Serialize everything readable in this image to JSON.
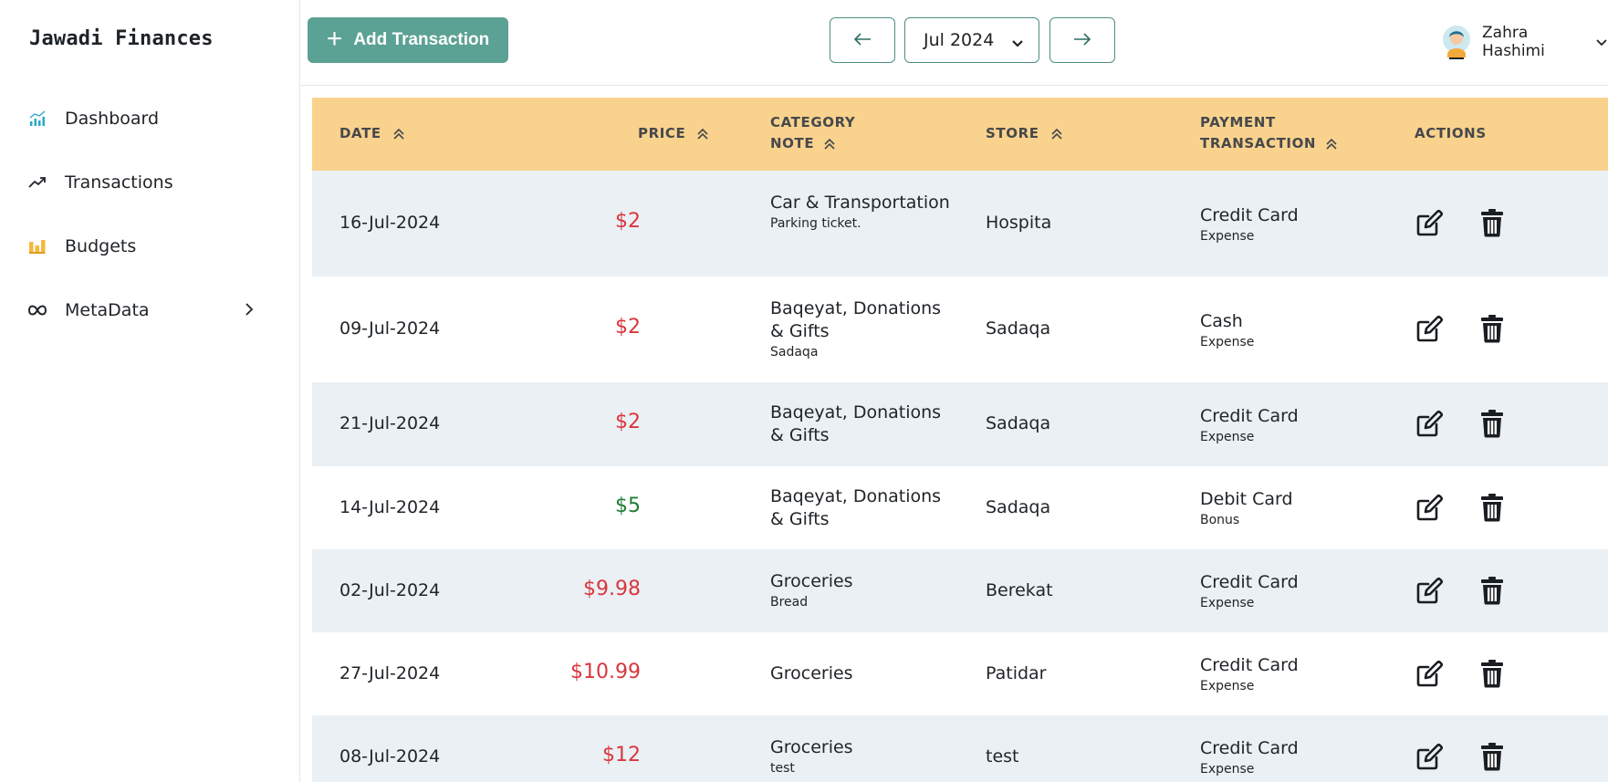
{
  "sidebar": {
    "brand": "Jawadi Finances",
    "items": [
      {
        "label": "Dashboard",
        "icon": "chart-bar-icon"
      },
      {
        "label": "Transactions",
        "icon": "trend-up-icon"
      },
      {
        "label": "Budgets",
        "icon": "budget-bars-icon"
      },
      {
        "label": "MetaData",
        "icon": "meta-infinity-icon"
      }
    ]
  },
  "header": {
    "add_label": "Add Transaction",
    "month": "Jul 2024",
    "user_name": "Zahra Hashimi"
  },
  "colors": {
    "accent": "#5ba194",
    "header_bg": "#f9d28d",
    "row_alt": "#ebf0f4",
    "expense": "#d9363e",
    "income": "#1e7e34"
  },
  "table": {
    "headers": {
      "date": "DATE",
      "price": "PRICE",
      "category_line1": "CATEGORY",
      "category_line2": "NOTE",
      "store": "STORE",
      "payment_line1": "PAYMENT",
      "payment_line2": "TRANSACTION",
      "actions": "ACTIONS"
    },
    "rows": [
      {
        "date": "16-Jul-2024",
        "price": "$2",
        "type": "expense",
        "category": "Car & Transportation",
        "note": "Parking ticket.",
        "store": "Hospita",
        "payment": "Credit Card",
        "transaction": "Expense"
      },
      {
        "date": "09-Jul-2024",
        "price": "$2",
        "type": "expense",
        "category": "Baqeyat, Donations & Gifts",
        "note": "Sadaqa",
        "store": "Sadaqa",
        "payment": "Cash",
        "transaction": "Expense"
      },
      {
        "date": "21-Jul-2024",
        "price": "$2",
        "type": "expense",
        "category": "Baqeyat, Donations & Gifts",
        "note": "",
        "store": "Sadaqa",
        "payment": "Credit Card",
        "transaction": "Expense"
      },
      {
        "date": "14-Jul-2024",
        "price": "$5",
        "type": "income",
        "category": "Baqeyat, Donations & Gifts",
        "note": "",
        "store": "Sadaqa",
        "payment": "Debit Card",
        "transaction": "Bonus"
      },
      {
        "date": "02-Jul-2024",
        "price": "$9.98",
        "type": "expense",
        "category": "Groceries",
        "note": "Bread",
        "store": "Berekat",
        "payment": "Credit Card",
        "transaction": "Expense"
      },
      {
        "date": "27-Jul-2024",
        "price": "$10.99",
        "type": "expense",
        "category": "Groceries",
        "note": "",
        "store": "Patidar",
        "payment": "Credit Card",
        "transaction": "Expense"
      },
      {
        "date": "08-Jul-2024",
        "price": "$12",
        "type": "expense",
        "category": "Groceries",
        "note": "test",
        "store": "test",
        "payment": "Credit Card",
        "transaction": "Expense"
      }
    ]
  }
}
